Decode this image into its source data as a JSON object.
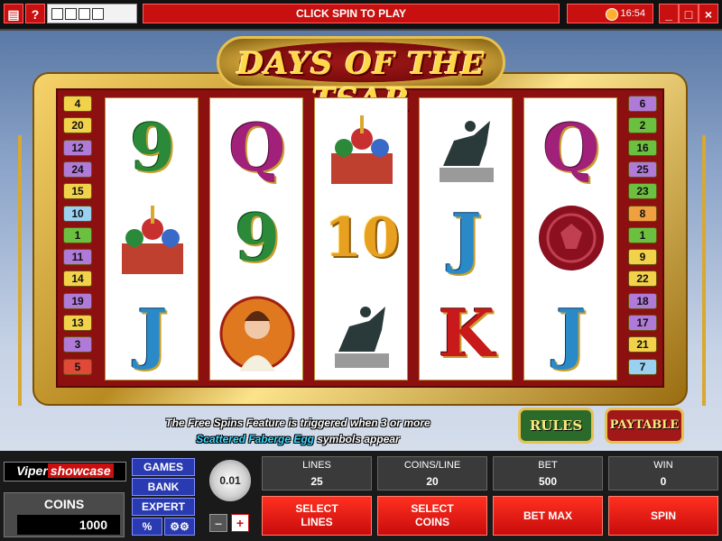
{
  "top_bar": {
    "menu_icon": "menu-icon",
    "help_label": "?",
    "message": "CLICK SPIN TO PLAY",
    "time": "16:54",
    "window_controls": [
      "_",
      "□",
      "×"
    ]
  },
  "game": {
    "title": "DAYS OF THE TSAR"
  },
  "line_markers": {
    "left": [
      "4",
      "20",
      "12",
      "24",
      "15",
      "10",
      "1",
      "11",
      "14",
      "19",
      "13",
      "3",
      "5"
    ],
    "right": [
      "6",
      "2",
      "16",
      "25",
      "23",
      "8",
      "1",
      "9",
      "22",
      "18",
      "17",
      "21",
      "7"
    ]
  },
  "reels": [
    {
      "symbols": [
        "9",
        "cathedral",
        "J"
      ]
    },
    {
      "symbols": [
        "Q",
        "9",
        "tsarina"
      ]
    },
    {
      "symbols": [
        "cathedral",
        "10",
        "horseman"
      ]
    },
    {
      "symbols": [
        "horseman",
        "J",
        "K"
      ]
    },
    {
      "symbols": [
        "Q",
        "wax-seal",
        "J"
      ]
    }
  ],
  "info": {
    "line1": "The Free Spins Feature is triggered when 3 or more",
    "line2_highlight": "Scattered Faberge Egg",
    "line2_rest": " symbols appear"
  },
  "buttons": {
    "rules": "RULES",
    "paytable": "PAYTABLE"
  },
  "panel": {
    "brand_left": "Viper",
    "brand_right": "showcase",
    "coins_label": "COINS",
    "coins_value": "1000",
    "games": "GAMES",
    "bank": "BANK",
    "expert": "EXPERT",
    "percent": "%",
    "coin_size": "0.01",
    "minus": "–",
    "plus": "+",
    "lines_label": "LINES",
    "lines_value": "25",
    "coins_line_label": "COINS/LINE",
    "coins_line_value": "20",
    "bet_label": "BET",
    "bet_value": "500",
    "win_label": "WIN",
    "win_value": "0",
    "select_lines": "SELECT LINES",
    "select_coins": "SELECT COINS",
    "bet_max": "BET MAX",
    "spin": "SPIN"
  }
}
